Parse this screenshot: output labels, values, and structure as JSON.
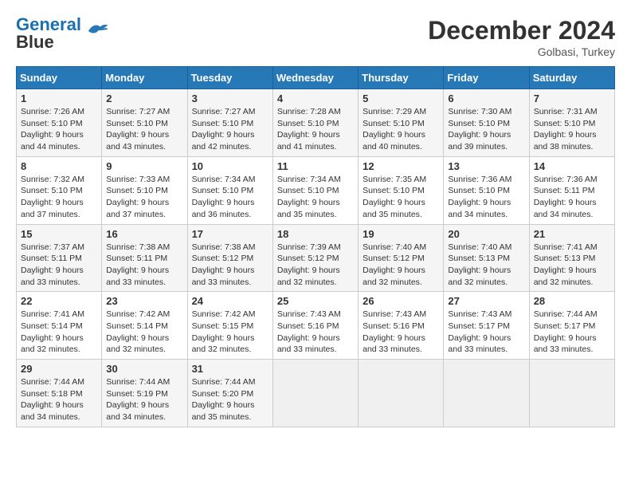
{
  "header": {
    "logo_line1": "General",
    "logo_line2": "Blue",
    "month": "December 2024",
    "location": "Golbasi, Turkey"
  },
  "weekdays": [
    "Sunday",
    "Monday",
    "Tuesday",
    "Wednesday",
    "Thursday",
    "Friday",
    "Saturday"
  ],
  "weeks": [
    [
      {
        "day": "1",
        "sunrise": "Sunrise: 7:26 AM",
        "sunset": "Sunset: 5:10 PM",
        "daylight": "Daylight: 9 hours and 44 minutes."
      },
      {
        "day": "2",
        "sunrise": "Sunrise: 7:27 AM",
        "sunset": "Sunset: 5:10 PM",
        "daylight": "Daylight: 9 hours and 43 minutes."
      },
      {
        "day": "3",
        "sunrise": "Sunrise: 7:27 AM",
        "sunset": "Sunset: 5:10 PM",
        "daylight": "Daylight: 9 hours and 42 minutes."
      },
      {
        "day": "4",
        "sunrise": "Sunrise: 7:28 AM",
        "sunset": "Sunset: 5:10 PM",
        "daylight": "Daylight: 9 hours and 41 minutes."
      },
      {
        "day": "5",
        "sunrise": "Sunrise: 7:29 AM",
        "sunset": "Sunset: 5:10 PM",
        "daylight": "Daylight: 9 hours and 40 minutes."
      },
      {
        "day": "6",
        "sunrise": "Sunrise: 7:30 AM",
        "sunset": "Sunset: 5:10 PM",
        "daylight": "Daylight: 9 hours and 39 minutes."
      },
      {
        "day": "7",
        "sunrise": "Sunrise: 7:31 AM",
        "sunset": "Sunset: 5:10 PM",
        "daylight": "Daylight: 9 hours and 38 minutes."
      }
    ],
    [
      {
        "day": "8",
        "sunrise": "Sunrise: 7:32 AM",
        "sunset": "Sunset: 5:10 PM",
        "daylight": "Daylight: 9 hours and 37 minutes."
      },
      {
        "day": "9",
        "sunrise": "Sunrise: 7:33 AM",
        "sunset": "Sunset: 5:10 PM",
        "daylight": "Daylight: 9 hours and 37 minutes."
      },
      {
        "day": "10",
        "sunrise": "Sunrise: 7:34 AM",
        "sunset": "Sunset: 5:10 PM",
        "daylight": "Daylight: 9 hours and 36 minutes."
      },
      {
        "day": "11",
        "sunrise": "Sunrise: 7:34 AM",
        "sunset": "Sunset: 5:10 PM",
        "daylight": "Daylight: 9 hours and 35 minutes."
      },
      {
        "day": "12",
        "sunrise": "Sunrise: 7:35 AM",
        "sunset": "Sunset: 5:10 PM",
        "daylight": "Daylight: 9 hours and 35 minutes."
      },
      {
        "day": "13",
        "sunrise": "Sunrise: 7:36 AM",
        "sunset": "Sunset: 5:10 PM",
        "daylight": "Daylight: 9 hours and 34 minutes."
      },
      {
        "day": "14",
        "sunrise": "Sunrise: 7:36 AM",
        "sunset": "Sunset: 5:11 PM",
        "daylight": "Daylight: 9 hours and 34 minutes."
      }
    ],
    [
      {
        "day": "15",
        "sunrise": "Sunrise: 7:37 AM",
        "sunset": "Sunset: 5:11 PM",
        "daylight": "Daylight: 9 hours and 33 minutes."
      },
      {
        "day": "16",
        "sunrise": "Sunrise: 7:38 AM",
        "sunset": "Sunset: 5:11 PM",
        "daylight": "Daylight: 9 hours and 33 minutes."
      },
      {
        "day": "17",
        "sunrise": "Sunrise: 7:38 AM",
        "sunset": "Sunset: 5:12 PM",
        "daylight": "Daylight: 9 hours and 33 minutes."
      },
      {
        "day": "18",
        "sunrise": "Sunrise: 7:39 AM",
        "sunset": "Sunset: 5:12 PM",
        "daylight": "Daylight: 9 hours and 32 minutes."
      },
      {
        "day": "19",
        "sunrise": "Sunrise: 7:40 AM",
        "sunset": "Sunset: 5:12 PM",
        "daylight": "Daylight: 9 hours and 32 minutes."
      },
      {
        "day": "20",
        "sunrise": "Sunrise: 7:40 AM",
        "sunset": "Sunset: 5:13 PM",
        "daylight": "Daylight: 9 hours and 32 minutes."
      },
      {
        "day": "21",
        "sunrise": "Sunrise: 7:41 AM",
        "sunset": "Sunset: 5:13 PM",
        "daylight": "Daylight: 9 hours and 32 minutes."
      }
    ],
    [
      {
        "day": "22",
        "sunrise": "Sunrise: 7:41 AM",
        "sunset": "Sunset: 5:14 PM",
        "daylight": "Daylight: 9 hours and 32 minutes."
      },
      {
        "day": "23",
        "sunrise": "Sunrise: 7:42 AM",
        "sunset": "Sunset: 5:14 PM",
        "daylight": "Daylight: 9 hours and 32 minutes."
      },
      {
        "day": "24",
        "sunrise": "Sunrise: 7:42 AM",
        "sunset": "Sunset: 5:15 PM",
        "daylight": "Daylight: 9 hours and 32 minutes."
      },
      {
        "day": "25",
        "sunrise": "Sunrise: 7:43 AM",
        "sunset": "Sunset: 5:16 PM",
        "daylight": "Daylight: 9 hours and 33 minutes."
      },
      {
        "day": "26",
        "sunrise": "Sunrise: 7:43 AM",
        "sunset": "Sunset: 5:16 PM",
        "daylight": "Daylight: 9 hours and 33 minutes."
      },
      {
        "day": "27",
        "sunrise": "Sunrise: 7:43 AM",
        "sunset": "Sunset: 5:17 PM",
        "daylight": "Daylight: 9 hours and 33 minutes."
      },
      {
        "day": "28",
        "sunrise": "Sunrise: 7:44 AM",
        "sunset": "Sunset: 5:17 PM",
        "daylight": "Daylight: 9 hours and 33 minutes."
      }
    ],
    [
      {
        "day": "29",
        "sunrise": "Sunrise: 7:44 AM",
        "sunset": "Sunset: 5:18 PM",
        "daylight": "Daylight: 9 hours and 34 minutes."
      },
      {
        "day": "30",
        "sunrise": "Sunrise: 7:44 AM",
        "sunset": "Sunset: 5:19 PM",
        "daylight": "Daylight: 9 hours and 34 minutes."
      },
      {
        "day": "31",
        "sunrise": "Sunrise: 7:44 AM",
        "sunset": "Sunset: 5:20 PM",
        "daylight": "Daylight: 9 hours and 35 minutes."
      },
      null,
      null,
      null,
      null
    ]
  ]
}
